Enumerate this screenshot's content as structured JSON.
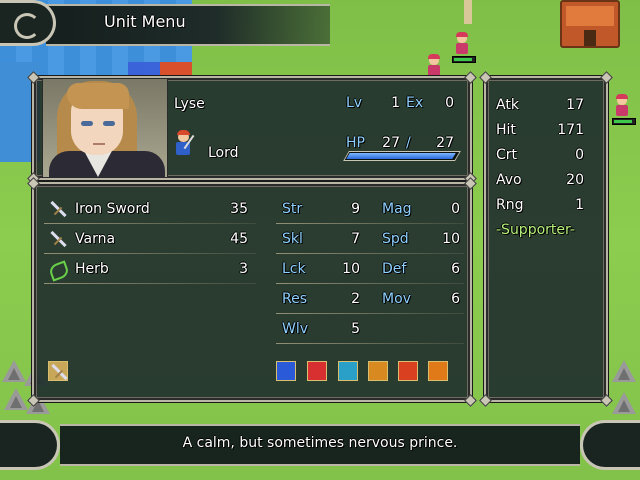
{
  "title": "Unit Menu",
  "unit": {
    "name": "Lyse",
    "class": "Lord",
    "level_label": "Lv",
    "level": "1",
    "exp_label": "Ex",
    "exp": "0",
    "hp_label": "HP",
    "hp_current": "27",
    "hp_separator": "/",
    "hp_max": "27",
    "hp_fraction": 1.0
  },
  "items": [
    {
      "name": "Iron Sword",
      "uses": "35",
      "icon": "sword-icon"
    },
    {
      "name": "Varna",
      "uses": "45",
      "icon": "sword-icon"
    },
    {
      "name": "Herb",
      "uses": "3",
      "icon": "herb-icon"
    }
  ],
  "stats": {
    "str_label": "Str",
    "str": "9",
    "mag_label": "Mag",
    "mag": "0",
    "skl_label": "Skl",
    "skl": "7",
    "spd_label": "Spd",
    "spd": "10",
    "lck_label": "Lck",
    "lck": "10",
    "def_label": "Def",
    "def": "6",
    "res_label": "Res",
    "res": "2",
    "mov_label": "Mov",
    "mov": "6",
    "wlv_label": "Wlv",
    "wlv": "5"
  },
  "combat": {
    "atk_label": "Atk",
    "atk": "17",
    "hit_label": "Hit",
    "hit": "171",
    "crt_label": "Crt",
    "crt": "0",
    "avo_label": "Avo",
    "avo": "20",
    "rng_label": "Rng",
    "rng": "1",
    "support": "-Supporter-"
  },
  "skills": [
    {
      "icon": "crown-icon",
      "color": "#2a5ad8"
    },
    {
      "icon": "slash-icon",
      "color": "#d83030"
    },
    {
      "icon": "star-burst-icon",
      "color": "#2aa0c8"
    },
    {
      "icon": "star-shield-icon",
      "color": "#d88a20"
    },
    {
      "icon": "swirl-icon",
      "color": "#d84020"
    },
    {
      "icon": "gold-star-icon",
      "color": "#e07a18"
    }
  ],
  "description": "A calm, but sometimes nervous prince.",
  "colors": {
    "label_blue": "#8ed0ff",
    "item_green": "#b6f07a",
    "window_bg": "#22322e"
  }
}
